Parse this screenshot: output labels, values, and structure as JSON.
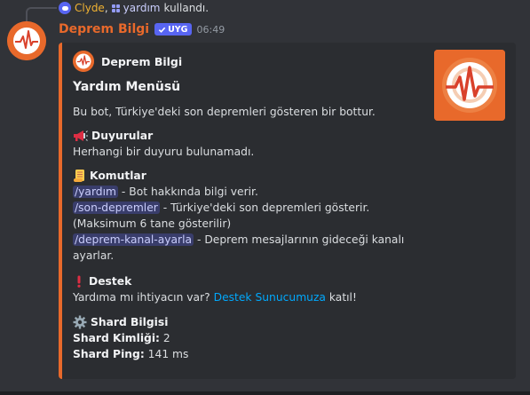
{
  "reply": {
    "user": "Clyde",
    "separator": ",",
    "command": "yardım",
    "suffix": "kullandı."
  },
  "message": {
    "username": "Deprem Bilgi",
    "app_tag": "UYG",
    "timestamp": "06:49"
  },
  "embed": {
    "accent_color": "#e8692b",
    "author": "Deprem Bilgi",
    "title": "Yardım Menüsü",
    "description": "Bu bot, Türkiye'deki son depremleri gösteren bir bottur.",
    "fields": {
      "announcements": {
        "icon": "megaphone-icon",
        "name": "Duyurular",
        "value": "Herhangi bir duyuru bulunamadı."
      },
      "commands": {
        "icon": "scroll-icon",
        "name": "Komutlar",
        "lines": [
          {
            "cmd": "/yardım",
            "text": " - Bot hakkında bilgi verir."
          },
          {
            "cmd": "/son-depremler",
            "text": " - Türkiye'deki son depremleri gösterir."
          },
          {
            "cmd": "",
            "text": "(Maksimum 6 tane gösterilir)"
          },
          {
            "cmd": "/deprem-kanal-ayarla",
            "text": " - Deprem mesajlarının gideceği kanalı"
          },
          {
            "cmd": "",
            "text": "ayarlar."
          }
        ]
      },
      "support": {
        "icon": "exclamation-icon",
        "name": "Destek",
        "prefix": "Yardıma mı ihtiyacın var? ",
        "link": "Destek Sunucumuza",
        "suffix": " katıl!"
      },
      "shard": {
        "icon": "gear-icon",
        "name": "Shard Bilgisi",
        "id_label": "Shard Kimliği:",
        "id_value": " 2",
        "ping_label": "Shard Ping:",
        "ping_value": " 141 ms"
      }
    }
  }
}
